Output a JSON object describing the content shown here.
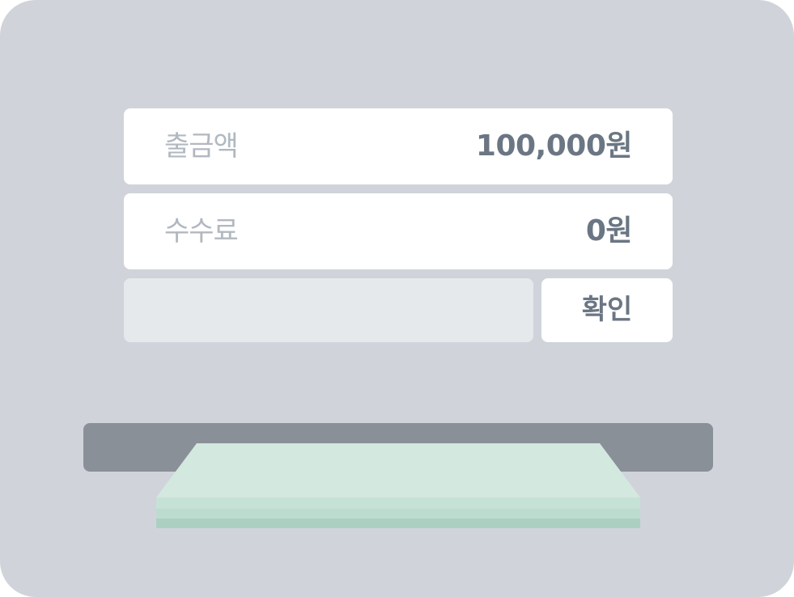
{
  "screen": {
    "amount": {
      "label": "출금액",
      "value": "100,000원"
    },
    "fee": {
      "label": "수수료",
      "value": "0원"
    },
    "pin_input": {
      "value": ""
    },
    "confirm_label": "확인"
  },
  "colors": {
    "machine_body": "#d0d4da",
    "panel": "#ffffff",
    "label_text": "#b1b8c0",
    "value_text": "#6b7684",
    "input_bg": "#e6e9ec",
    "slot": "#8a9098",
    "cash_light": "#d3e8df",
    "cash_mid": "#bcdccf",
    "cash_dark": "#abd0c2"
  },
  "icons": {
    "cash": "cash-stack-icon"
  }
}
